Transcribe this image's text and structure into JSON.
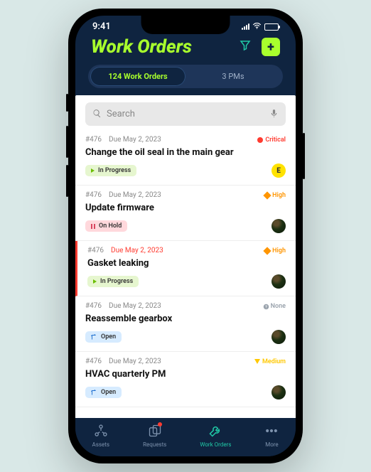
{
  "status": {
    "time": "9:41"
  },
  "header": {
    "title": "Work Orders"
  },
  "tabs": [
    {
      "label": "124 Work Orders"
    },
    {
      "label": "3 PMs"
    }
  ],
  "search": {
    "placeholder": "Search"
  },
  "cards": [
    {
      "id": "#476",
      "due": "Due May 2, 2023",
      "priority": "Critical",
      "ptype": "critical",
      "title": "Change the oil seal in the main gear",
      "status": "In Progress",
      "stype": "inprogress",
      "avatar": "letter",
      "letter": "E"
    },
    {
      "id": "#476",
      "due": "Due May 2, 2023",
      "priority": "High",
      "ptype": "high",
      "title": "Update firmware",
      "status": "On Hold",
      "stype": "onhold",
      "avatar": "img"
    },
    {
      "id": "#476",
      "due": "Due May 2, 2023",
      "priority": "High",
      "ptype": "high",
      "title": "Gasket leaking",
      "status": "In Progress",
      "stype": "inprogress",
      "avatar": "img",
      "overdue": true,
      "urgent": true
    },
    {
      "id": "#476",
      "due": "Due May 2, 2023",
      "priority": "None",
      "ptype": "none",
      "title": "Reassemble gearbox",
      "status": "Open",
      "stype": "open",
      "avatar": "img"
    },
    {
      "id": "#476",
      "due": "Due May 2, 2023",
      "priority": "Medium",
      "ptype": "medium",
      "title": "HVAC quarterly PM",
      "status": "Open",
      "stype": "open",
      "avatar": "img"
    }
  ],
  "nav": [
    {
      "label": "Assets",
      "icon": "assets"
    },
    {
      "label": "Requests",
      "icon": "requests",
      "badge": true
    },
    {
      "label": "Work Orders",
      "icon": "wrench",
      "active": true
    },
    {
      "label": "More",
      "icon": "more"
    }
  ]
}
